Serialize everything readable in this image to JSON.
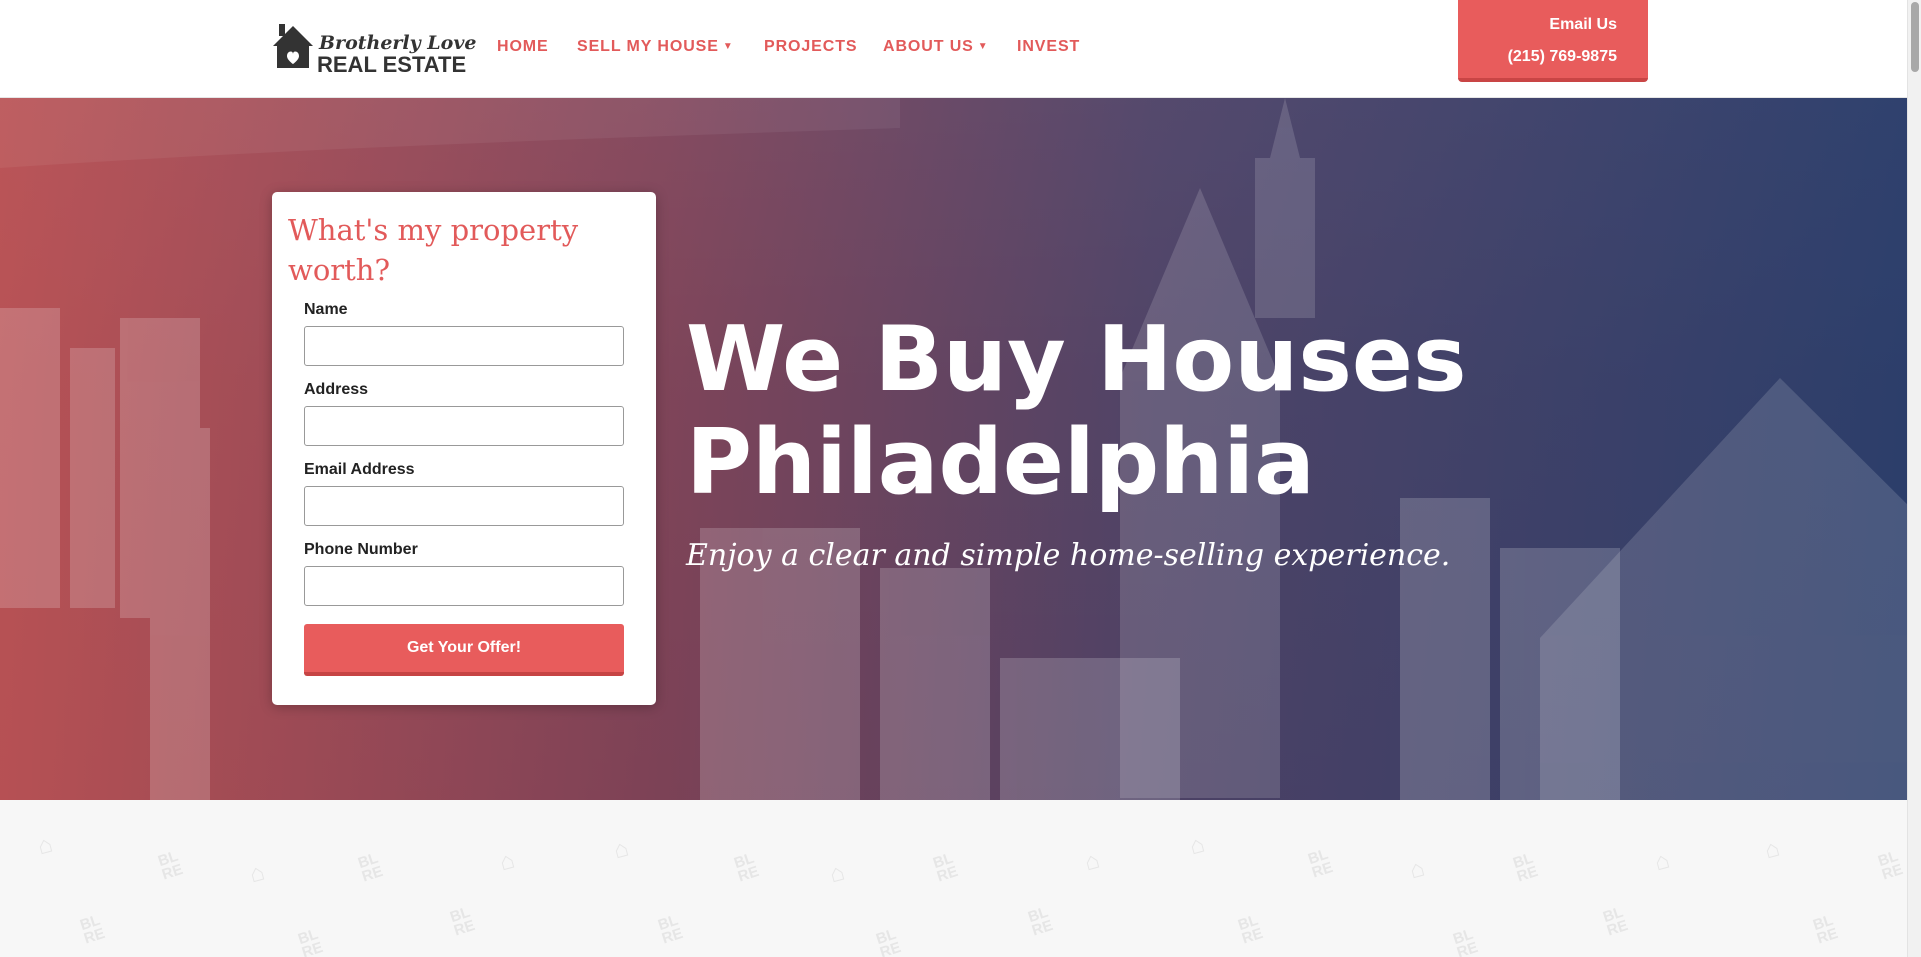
{
  "brand": {
    "logo_line1": "Brotherly Love",
    "logo_line2": "REAL ESTATE"
  },
  "nav": {
    "items": [
      {
        "label": "HOME",
        "has_dropdown": false
      },
      {
        "label": "SELL MY HOUSE",
        "has_dropdown": true
      },
      {
        "label": "PROJECTS",
        "has_dropdown": false
      },
      {
        "label": "ABOUT US",
        "has_dropdown": true
      },
      {
        "label": "INVEST",
        "has_dropdown": false
      }
    ]
  },
  "contact": {
    "email_label": "Email Us",
    "phone": "(215) 769-9875"
  },
  "form": {
    "title": "What's my property worth?",
    "fields": [
      {
        "label": "Name",
        "value": ""
      },
      {
        "label": "Address",
        "value": ""
      },
      {
        "label": "Email Address",
        "value": ""
      },
      {
        "label": "Phone Number",
        "value": ""
      }
    ],
    "submit_label": "Get Your Offer!"
  },
  "hero": {
    "heading_line1": "We Buy Houses",
    "heading_line2": "Philadelphia",
    "subheading": "Enjoy a clear and simple home-selling experience."
  },
  "pattern": {
    "text": [
      "BL",
      "RE"
    ]
  },
  "colors": {
    "accent": "#e85c5c",
    "nav_text": "#e25a5a",
    "hero_overlay_left": "#c35254",
    "hero_overlay_right": "#283c6c"
  }
}
